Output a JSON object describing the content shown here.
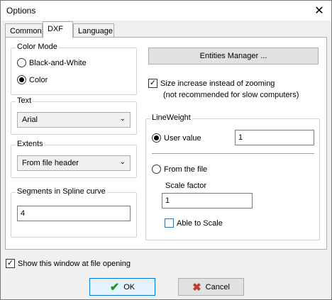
{
  "window": {
    "title": "Options"
  },
  "tabs": [
    {
      "label": "Common"
    },
    {
      "label": "DXF"
    },
    {
      "label": "Language"
    }
  ],
  "color_mode": {
    "title": "Color Mode",
    "options": [
      {
        "label": "Black-and-White",
        "selected": false
      },
      {
        "label": "Color",
        "selected": true
      }
    ]
  },
  "text": {
    "title": "Text",
    "value": "Arial"
  },
  "extents": {
    "title": "Extents",
    "value": "From file header"
  },
  "segments": {
    "title": "Segments in Spline curve",
    "value": "4"
  },
  "entities_manager": {
    "label": "Entities Manager ..."
  },
  "size_increase": {
    "label": "Size increase instead of zooming",
    "note": "(not recommended for slow computers)",
    "checked": true
  },
  "lineweight": {
    "title": "LineWeight",
    "user_value_label": "User value",
    "user_value": "1",
    "from_file_label": "From the file",
    "scale_factor_label": "Scale factor",
    "scale_factor": "1",
    "able_to_scale_label": "Able to Scale",
    "able_to_scale_checked": false
  },
  "show_window": {
    "label": "Show this window at file opening",
    "checked": true
  },
  "buttons": {
    "ok": "OK",
    "cancel": "Cancel"
  },
  "colors": {
    "ok_check": "#1a9a1a",
    "cancel_x": "#c0392b"
  }
}
